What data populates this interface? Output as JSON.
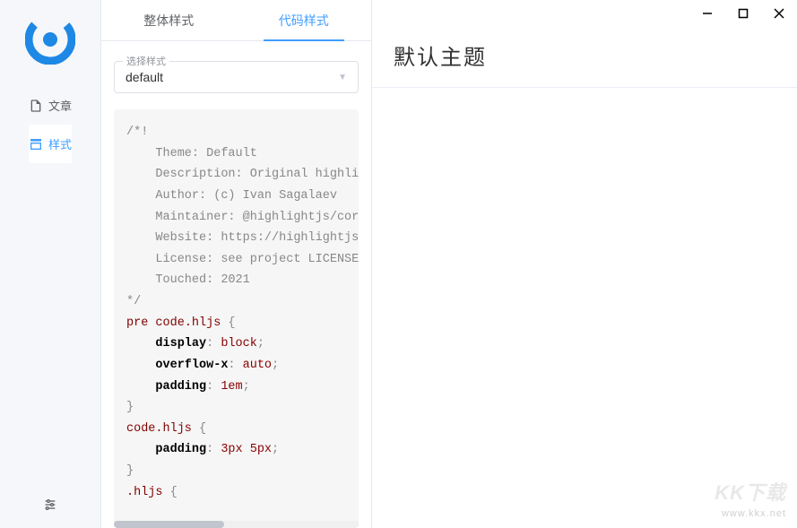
{
  "sidebar": {
    "nav": [
      {
        "label": "文章",
        "icon": "document-icon",
        "active": false
      },
      {
        "label": "样式",
        "icon": "style-icon",
        "active": true
      }
    ]
  },
  "tabs": [
    {
      "label": "整体样式",
      "active": false
    },
    {
      "label": "代码样式",
      "active": true
    }
  ],
  "select": {
    "label": "选择样式",
    "value": "default"
  },
  "code_lines": [
    {
      "text": "/*!",
      "cls": "comment"
    },
    {
      "text": "    Theme: Default",
      "cls": "comment"
    },
    {
      "text": "    Description: Original highli",
      "cls": "comment"
    },
    {
      "text": "    Author: (c) Ivan Sagalaev <m",
      "cls": "comment"
    },
    {
      "text": "    Maintainer: @highlightjs/cor",
      "cls": "comment"
    },
    {
      "text": "    Website: https://highlightjs",
      "cls": "comment"
    },
    {
      "text": "    License: see project LICENSE",
      "cls": "comment"
    },
    {
      "text": "    Touched: 2021",
      "cls": "comment"
    },
    {
      "text": "*/",
      "cls": "comment"
    }
  ],
  "code_rules": [
    {
      "selector_tag": "pre ",
      "selector_tag2": "code",
      "selector_class": ".hljs",
      "decls": [
        {
          "prop": "display",
          "val": "block"
        },
        {
          "prop": "overflow-x",
          "val": "auto"
        },
        {
          "prop": "padding",
          "val": "1em"
        }
      ]
    },
    {
      "selector_tag": "",
      "selector_tag2": "code",
      "selector_class": ".hljs",
      "decls": [
        {
          "prop": "padding",
          "val": "3px 5px"
        }
      ]
    },
    {
      "selector_tag": "",
      "selector_tag2": "",
      "selector_class": ".hljs",
      "decls": []
    }
  ],
  "main": {
    "title": "默认主题"
  },
  "watermark": {
    "big": "KK下载",
    "small": "www.kkx.net"
  }
}
